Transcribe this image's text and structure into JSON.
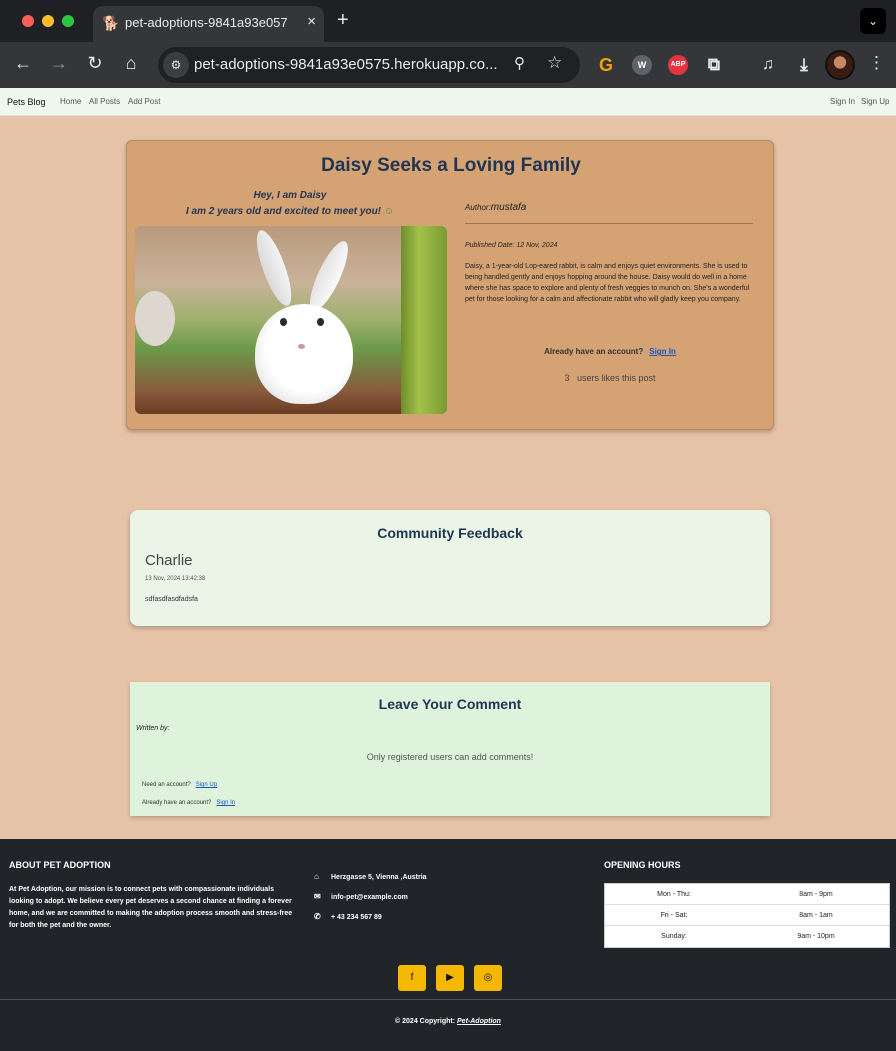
{
  "browser": {
    "tab_title": "pet-adoptions-9841a93e057",
    "tab_favicon": "🐕",
    "url": "pet-adoptions-9841a93e0575.herokuapp.co...",
    "new_tab": "+",
    "close_tab": "×"
  },
  "nav": {
    "brand": "Pets Blog",
    "home": "Home",
    "all_posts": "All Posts",
    "add_post": "Add Post",
    "sign_in": "Sign In",
    "sign_up": "Sign Up"
  },
  "post": {
    "title": "Daisy Seeks a Loving Family",
    "greeting_line1": "Hey, I am Daisy",
    "greeting_line2": "I am 2 years old and excited to meet you!",
    "smile": "☺",
    "author_label": "Author:",
    "author": "mustafa",
    "published": "Published Date: 12 Nov, 2024",
    "body": "Daisy, a 1-year-old Lop-eared rabbit, is calm and enjoys quiet environments. She is used to being handled gently and enjoys hopping around the house. Daisy would do well in a home where she has space to explore and plenty of fresh veggies to munch on. She's a wonderful pet for those looking for a calm and affectionate rabbit who will gladly keep you company.",
    "account_prompt": "Already have an account?",
    "sign_in_link": "Sign In",
    "likes_count": "3",
    "likes_text": "users likes this post"
  },
  "feedback": {
    "title": "Community Feedback",
    "comments": [
      {
        "author": "Charlie",
        "time": "13 Nov, 2024 13:42:38",
        "text": "sdfasdfasdfadsfa"
      }
    ]
  },
  "leave_comment": {
    "title": "Leave Your Comment",
    "written_by": "Written by:",
    "notice": "Only registered users can add comments!",
    "need_account": "Need an account?",
    "sign_up_link": "Sign Up",
    "have_account": "Already have an account?",
    "sign_in_link": "Sign In"
  },
  "footer": {
    "about_title": "ABOUT PET ADOPTION",
    "about_text": "At Pet Adoption, our mission is to connect pets with compassionate individuals looking to adopt. We believe every pet deserves a second chance at finding a forever home, and we are committed to making the adoption process smooth and stress-free for both the pet and the owner.",
    "address": "Herzgasse 5, Vienna ,Austria",
    "email": "info-pet@example.com",
    "phone": "+ 43 234 567 89",
    "hours_title": "OPENING HOURS",
    "hours": [
      {
        "day": "Mon - Thu:",
        "time": "8am - 9pm"
      },
      {
        "day": "Fri - Sat:",
        "time": "8am - 1am"
      },
      {
        "day": "Sunday:",
        "time": "9am - 10pm"
      }
    ],
    "copyright_prefix": "© 2024 Copyright:",
    "copyright_link": "Pet-Adoption"
  },
  "colors": {
    "page_bg": "#e6c3a6",
    "post_card": "#d5a274",
    "title_navy": "#1f3552",
    "footer_bg": "#212529",
    "social_yellow": "#f5b800"
  }
}
